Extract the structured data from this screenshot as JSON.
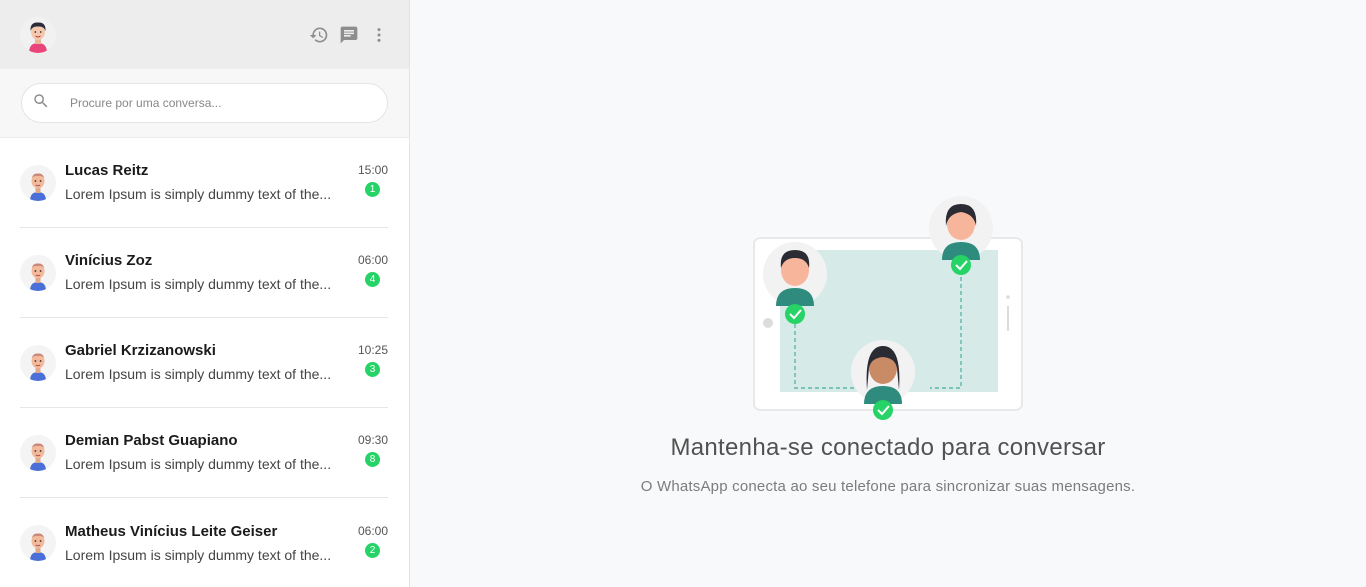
{
  "header": {
    "icons": [
      "history-icon",
      "new-chat-icon",
      "menu-dots-icon"
    ]
  },
  "search": {
    "placeholder": "Procure por uma conversa..."
  },
  "chats": [
    {
      "name": "Lucas Reitz",
      "preview": "Lorem Ipsum is simply dummy text of the...",
      "time": "15:00",
      "unread": "1"
    },
    {
      "name": "Vinícius Zoz",
      "preview": "Lorem Ipsum is simply dummy text of the...",
      "time": "06:00",
      "unread": "4"
    },
    {
      "name": "Gabriel Krzizanowski",
      "preview": "Lorem Ipsum is simply dummy text of the...",
      "time": "10:25",
      "unread": "3"
    },
    {
      "name": "Demian Pabst Guapiano",
      "preview": "Lorem Ipsum is simply dummy text of the...",
      "time": "09:30",
      "unread": "8"
    },
    {
      "name": "Matheus Vinícius Leite Geiser",
      "preview": "Lorem Ipsum is simply dummy text of the...",
      "time": "06:00",
      "unread": "2"
    }
  ],
  "main": {
    "title": "Mantenha-se conectado para conversar",
    "subtitle": "O WhatsApp conecta ao seu telefone para sincronizar suas mensagens."
  },
  "colors": {
    "accent_green": "#25d366",
    "header_bg": "#ededed",
    "main_bg": "#f8f9fa"
  }
}
